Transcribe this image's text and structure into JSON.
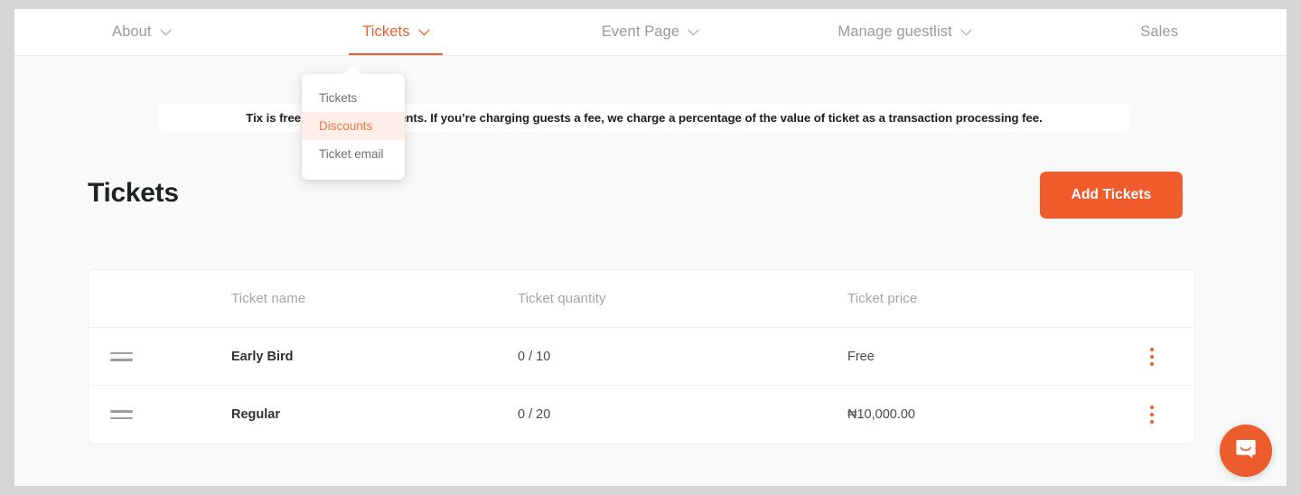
{
  "nav": {
    "items": [
      {
        "label": "About",
        "has_chevron": true,
        "active": false
      },
      {
        "label": "Tickets",
        "has_chevron": true,
        "active": true
      },
      {
        "label": "Event Page",
        "has_chevron": true,
        "active": false
      },
      {
        "label": "Manage guestlist",
        "has_chevron": true,
        "active": false
      },
      {
        "label": "Sales",
        "has_chevron": false,
        "active": false
      }
    ]
  },
  "dropdown": {
    "open_for": "Tickets",
    "items": [
      {
        "label": "Tickets",
        "highlighted": false
      },
      {
        "label": "Discounts",
        "highlighted": true
      },
      {
        "label": "Ticket email",
        "highlighted": false
      }
    ]
  },
  "banner": {
    "text": "Tix is free to use for free events. If you’re charging guests a fee, we charge a percentage of the value of ticket as a transaction processing fee."
  },
  "page": {
    "title": "Tickets",
    "add_button_label": "Add Tickets"
  },
  "table": {
    "headers": {
      "handle": "",
      "name": "Ticket name",
      "quantity": "Ticket quantity",
      "price": "Ticket price",
      "actions": ""
    },
    "rows": [
      {
        "name": "Early Bird",
        "quantity": "0 / 10",
        "price": "Free"
      },
      {
        "name": "Regular",
        "quantity": "0 / 20",
        "price": "₦10,000.00"
      }
    ]
  },
  "colors": {
    "accent": "#ef5b2b",
    "accent_soft": "#fdeee7",
    "page_bg": "#f8f9f9",
    "outer_bg": "#d6d6d6",
    "muted_text": "#9a9a9a"
  },
  "icons": {
    "chevron_down": "chevron-down-icon",
    "drag_handle": "drag-handle-icon",
    "overflow_menu": "more-vertical-icon",
    "chat": "chat-bubble-icon"
  }
}
